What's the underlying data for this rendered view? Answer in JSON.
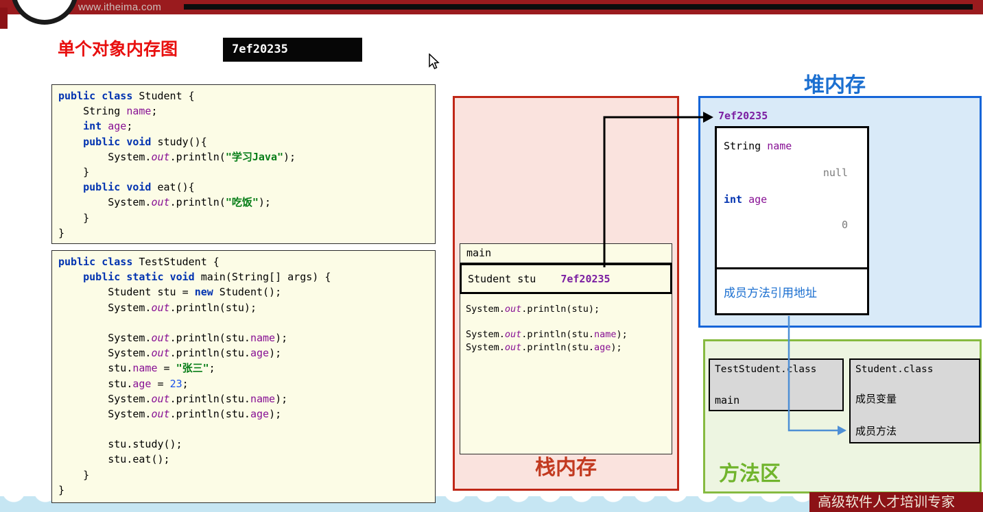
{
  "header": {
    "url": "www.itheima.com"
  },
  "slide": {
    "title": "单个对象内存图",
    "address_badge": "7ef20235"
  },
  "colors": {
    "header_maroon": "#9A1B1E",
    "title_red": "#E8100F",
    "code_bg_yellow": "#FCFCE6",
    "stack_bg_pink": "#FAE3DE",
    "stack_border_red": "#C02717",
    "stack_label_red": "#C23A20",
    "heap_bg_blue": "#D9EAF8",
    "heap_border_blue": "#1565D8",
    "heap_label_blue": "#1B6FD0",
    "method_bg_green": "#EDF5E1",
    "method_border_green": "#86BA40",
    "method_label_green": "#70B42C",
    "address_purple": "#7B1FA2",
    "arrow_blue": "#4E8FD5",
    "footer_maroon": "#8C1216",
    "wave_blue": "#C6E6F3"
  },
  "code": {
    "student": [
      [
        [
          "k",
          "public"
        ],
        [
          "p",
          " "
        ],
        [
          "k",
          "class"
        ],
        [
          "p",
          " Student {"
        ]
      ],
      [
        [
          "p",
          "    String "
        ],
        [
          "f",
          "name"
        ],
        [
          "p",
          ";"
        ]
      ],
      [
        [
          "p",
          "    "
        ],
        [
          "k",
          "int"
        ],
        [
          "p",
          " "
        ],
        [
          "f",
          "age"
        ],
        [
          "p",
          ";"
        ]
      ],
      [
        [
          "p",
          "    "
        ],
        [
          "k",
          "public"
        ],
        [
          "p",
          " "
        ],
        [
          "k",
          "void"
        ],
        [
          "p",
          " study(){"
        ]
      ],
      [
        [
          "p",
          "        System."
        ],
        [
          "o",
          "out"
        ],
        [
          "p",
          ".println("
        ],
        [
          "s",
          "\"学习Java\""
        ],
        [
          "p",
          ");"
        ]
      ],
      [
        [
          "p",
          "    }"
        ]
      ],
      [
        [
          "p",
          "    "
        ],
        [
          "k",
          "public"
        ],
        [
          "p",
          " "
        ],
        [
          "k",
          "void"
        ],
        [
          "p",
          " eat(){"
        ]
      ],
      [
        [
          "p",
          "        System."
        ],
        [
          "o",
          "out"
        ],
        [
          "p",
          ".println("
        ],
        [
          "s",
          "\"吃饭\""
        ],
        [
          "p",
          ");"
        ]
      ],
      [
        [
          "p",
          "    }"
        ]
      ],
      [
        [
          "p",
          "}"
        ]
      ]
    ],
    "test_student": [
      [
        [
          "k",
          "public"
        ],
        [
          "p",
          " "
        ],
        [
          "k",
          "class"
        ],
        [
          "p",
          " TestStudent {"
        ]
      ],
      [
        [
          "p",
          "    "
        ],
        [
          "k",
          "public"
        ],
        [
          "p",
          " "
        ],
        [
          "k",
          "static"
        ],
        [
          "p",
          " "
        ],
        [
          "k",
          "void"
        ],
        [
          "p",
          " main(String[] args) {"
        ]
      ],
      [
        [
          "p",
          "        Student stu = "
        ],
        [
          "k",
          "new"
        ],
        [
          "p",
          " Student();"
        ]
      ],
      [
        [
          "p",
          "        System."
        ],
        [
          "o",
          "out"
        ],
        [
          "p",
          ".println(stu);"
        ]
      ],
      [],
      [
        [
          "p",
          "        System."
        ],
        [
          "o",
          "out"
        ],
        [
          "p",
          ".println(stu."
        ],
        [
          "f",
          "name"
        ],
        [
          "p",
          ");"
        ]
      ],
      [
        [
          "p",
          "        System."
        ],
        [
          "o",
          "out"
        ],
        [
          "p",
          ".println(stu."
        ],
        [
          "f",
          "age"
        ],
        [
          "p",
          ");"
        ]
      ],
      [
        [
          "p",
          "        stu."
        ],
        [
          "f",
          "name"
        ],
        [
          "p",
          " = "
        ],
        [
          "s",
          "\"张三\""
        ],
        [
          "p",
          ";"
        ]
      ],
      [
        [
          "p",
          "        stu."
        ],
        [
          "f",
          "age"
        ],
        [
          "p",
          " = "
        ],
        [
          "n",
          "23"
        ],
        [
          "p",
          ";"
        ]
      ],
      [
        [
          "p",
          "        System."
        ],
        [
          "o",
          "out"
        ],
        [
          "p",
          ".println(stu."
        ],
        [
          "f",
          "name"
        ],
        [
          "p",
          ");"
        ]
      ],
      [
        [
          "p",
          "        System."
        ],
        [
          "o",
          "out"
        ],
        [
          "p",
          ".println(stu."
        ],
        [
          "f",
          "age"
        ],
        [
          "p",
          ");"
        ]
      ],
      [],
      [
        [
          "p",
          "        stu.study();"
        ]
      ],
      [
        [
          "p",
          "        stu.eat();"
        ]
      ],
      [
        [
          "p",
          "    }"
        ]
      ],
      [
        [
          "p",
          "}"
        ]
      ]
    ]
  },
  "stack": {
    "label": "栈内存",
    "frame_title": "main",
    "variable": {
      "decl": "Student stu",
      "value": "7ef20235"
    },
    "statements": [
      [
        [
          "p",
          "System."
        ],
        [
          "o",
          "out"
        ],
        [
          "p",
          ".println(stu);"
        ]
      ],
      [],
      [
        [
          "p",
          "System."
        ],
        [
          "o",
          "out"
        ],
        [
          "p",
          ".println(stu."
        ],
        [
          "f",
          "name"
        ],
        [
          "p",
          ");"
        ]
      ],
      [
        [
          "p",
          "System."
        ],
        [
          "o",
          "out"
        ],
        [
          "p",
          ".println(stu."
        ],
        [
          "f",
          "age"
        ],
        [
          "p",
          ");"
        ]
      ]
    ]
  },
  "heap": {
    "label": "堆内存",
    "address": "7ef20235",
    "fields": [
      {
        "decl": [
          [
            "p",
            "String "
          ],
          [
            "f",
            "name"
          ]
        ],
        "value": "null"
      },
      {
        "decl": [
          [
            "k",
            "int"
          ],
          [
            "p",
            " "
          ],
          [
            "f",
            "age"
          ]
        ],
        "value": "0"
      }
    ],
    "method_ref_label": "成员方法引用地址"
  },
  "method_area": {
    "label": "方法区",
    "test_student_class": {
      "name": "TestStudent.class",
      "member": "main"
    },
    "student_class": {
      "name": "Student.class",
      "members": [
        "成员变量",
        "成员方法"
      ]
    }
  },
  "footer": {
    "slogan": "高级软件人才培训专家"
  }
}
